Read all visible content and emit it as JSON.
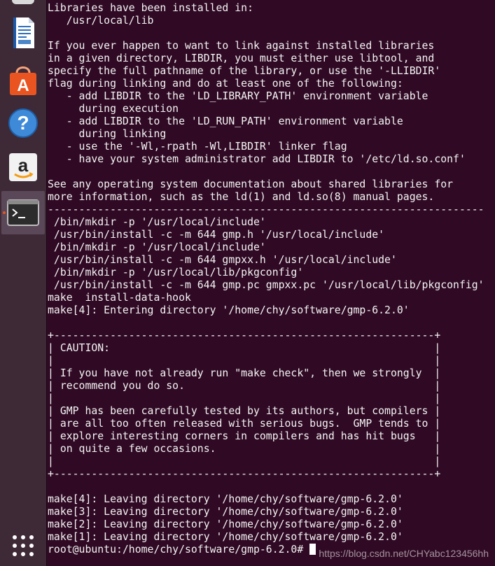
{
  "dock": {
    "items": [
      {
        "name": "LibreOffice Writer",
        "icon": "libreoffice-writer-icon"
      },
      {
        "name": "Ubuntu Software",
        "icon": "ubuntu-software-icon"
      },
      {
        "name": "Help",
        "icon": "help-icon"
      },
      {
        "name": "Amazon",
        "icon": "amazon-icon"
      },
      {
        "name": "Terminal",
        "icon": "terminal-icon",
        "active": true
      },
      {
        "name": "Show Applications",
        "icon": "app-grid-icon"
      }
    ],
    "accent": "#e95420"
  },
  "terminal": {
    "background": "#300a24",
    "foreground": "#f4f4f4",
    "lines": [
      "Libraries have been installed in:",
      "   /usr/local/lib",
      "",
      "If you ever happen to want to link against installed libraries",
      "in a given directory, LIBDIR, you must either use libtool, and",
      "specify the full pathname of the library, or use the '-LLIBDIR'",
      "flag during linking and do at least one of the following:",
      "   - add LIBDIR to the 'LD_LIBRARY_PATH' environment variable",
      "     during execution",
      "   - add LIBDIR to the 'LD_RUN_PATH' environment variable",
      "     during linking",
      "   - use the '-Wl,-rpath -Wl,LIBDIR' linker flag",
      "   - have your system administrator add LIBDIR to '/etc/ld.so.conf'",
      "",
      "See any operating system documentation about shared libraries for",
      "more information, such as the ld(1) and ld.so(8) manual pages.",
      "----------------------------------------------------------------------",
      " /bin/mkdir -p '/usr/local/include'",
      " /usr/bin/install -c -m 644 gmp.h '/usr/local/include'",
      " /bin/mkdir -p '/usr/local/include'",
      " /usr/bin/install -c -m 644 gmpxx.h '/usr/local/include'",
      " /bin/mkdir -p '/usr/local/lib/pkgconfig'",
      " /usr/bin/install -c -m 644 gmp.pc gmpxx.pc '/usr/local/lib/pkgconfig'",
      "make  install-data-hook",
      "make[4]: Entering directory '/home/chy/software/gmp-6.2.0'",
      "",
      "+-------------------------------------------------------------+",
      "| CAUTION:                                                    |",
      "|                                                             |",
      "| If you have not already run \"make check\", then we strongly  |",
      "| recommend you do so.                                        |",
      "|                                                             |",
      "| GMP has been carefully tested by its authors, but compilers |",
      "| are all too often released with serious bugs.  GMP tends to |",
      "| explore interesting corners in compilers and has hit bugs   |",
      "| on quite a few occasions.                                   |",
      "|                                                             |",
      "+-------------------------------------------------------------+",
      "",
      "make[4]: Leaving directory '/home/chy/software/gmp-6.2.0'",
      "make[3]: Leaving directory '/home/chy/software/gmp-6.2.0'",
      "make[2]: Leaving directory '/home/chy/software/gmp-6.2.0'",
      "make[1]: Leaving directory '/home/chy/software/gmp-6.2.0'"
    ],
    "prompt": "root@ubuntu:/home/chy/software/gmp-6.2.0# "
  },
  "watermark": "https://blog.csdn.net/CHYabc123456hh"
}
